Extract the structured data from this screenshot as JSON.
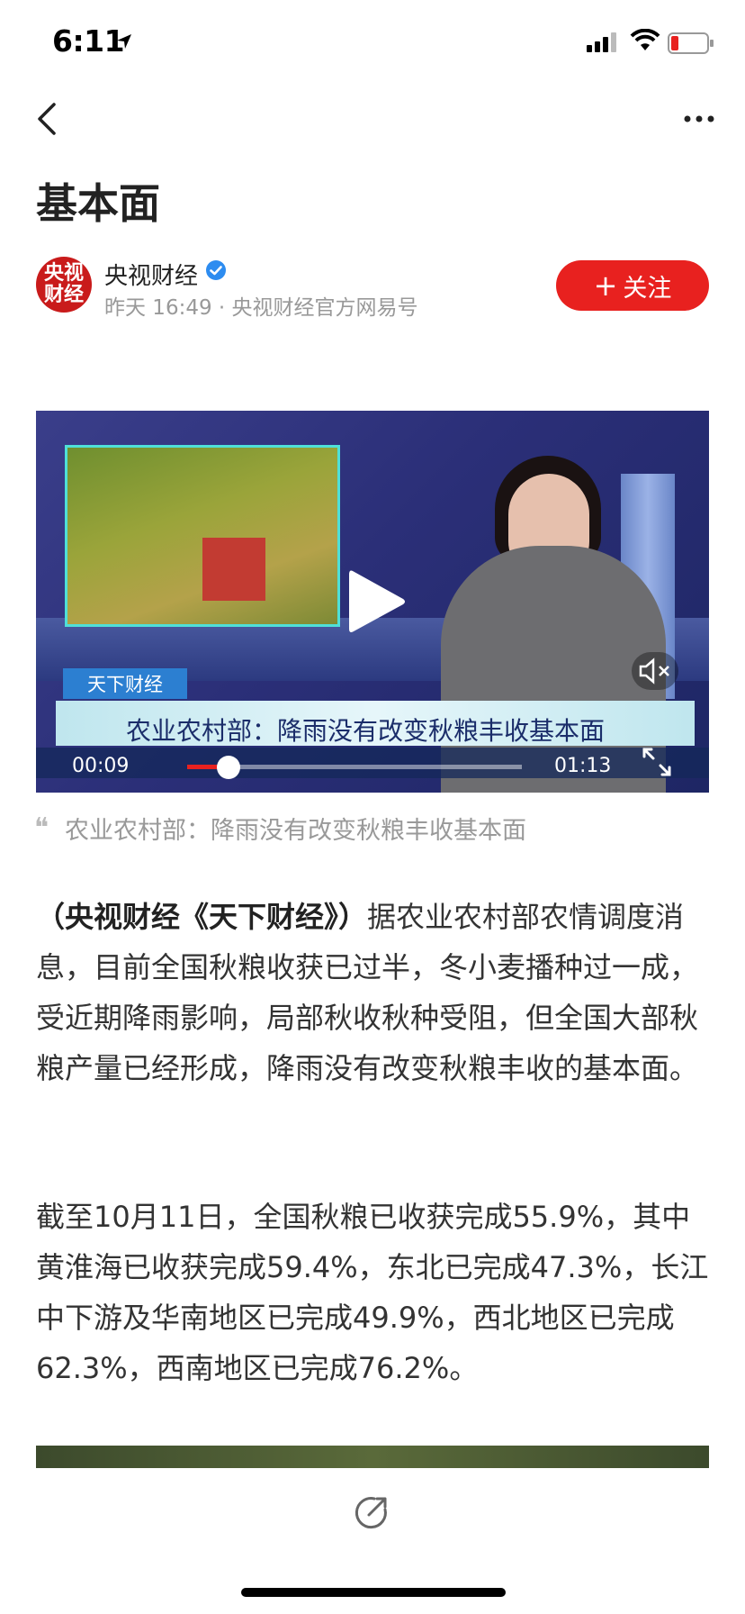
{
  "status_bar": {
    "time": "6:11"
  },
  "article": {
    "title": "基本面",
    "author": {
      "avatar_text": "央视\n财经",
      "name": "央视财经",
      "meta": "昨天 16:49 · 央视财经官方网易号"
    },
    "follow_label": "关注",
    "video": {
      "tag": "天下财经",
      "banner": "农业农村部：降雨没有改变秋粮丰收基本面",
      "time_current": "00:09",
      "time_total": "01:13",
      "progress": 0.123
    },
    "caption": "农业农村部：降雨没有改变秋粮丰收基本面",
    "paragraphs": [
      {
        "lead": "（央视财经《天下财经》）",
        "text": "据农业农村部农情调度消息，目前全国秋粮收获已过半，冬小麦播种过一成，受近期降雨影响，局部秋收秋种受阻，但全国大部秋粮产量已经形成，降雨没有改变秋粮丰收的基本面。"
      },
      {
        "lead": "",
        "text": "截至10月11日，全国秋粮已收获完成55.9%，其中黄淮海已收获完成59.4%，东北已完成47.3%，长江中下游及华南地区已完成49.9%，西北地区已完成62.3%，西南地区已完成76.2%。"
      }
    ]
  },
  "colors": {
    "accent": "#e8211f",
    "verified": "#2d8cf0",
    "avatar": "#c91b1b"
  },
  "icons": {
    "back": "chevron-left-icon",
    "more": "more-dots-icon",
    "play": "play-icon",
    "mute": "mute-icon",
    "fullscreen": "fullscreen-icon",
    "share": "share-icon"
  }
}
